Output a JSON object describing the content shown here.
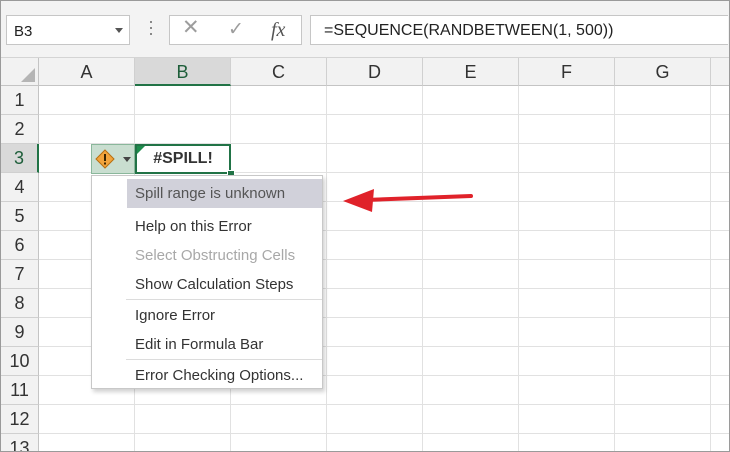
{
  "formula_bar": {
    "name_box": "B3",
    "cancel_glyph": "✕",
    "enter_glyph": "✓",
    "fx_glyph": "fx",
    "formula": "=SEQUENCE(RANDBETWEEN(1, 500))"
  },
  "grid": {
    "columns": [
      "A",
      "B",
      "C",
      "D",
      "E",
      "F",
      "G"
    ],
    "rows": [
      "1",
      "2",
      "3",
      "4",
      "5",
      "6",
      "7",
      "8",
      "9",
      "10",
      "11",
      "12",
      "13"
    ],
    "active_column": "B",
    "active_row": "3"
  },
  "active_cell": {
    "value": "#SPILL!"
  },
  "error_menu": {
    "header": "Spill range is unknown",
    "items": [
      {
        "label": "Help on this Error"
      },
      {
        "label": "Select Obstructing Cells"
      },
      {
        "label": "Show Calculation Steps"
      },
      {
        "label": "Ignore Error"
      },
      {
        "label": "Edit in Formula Bar"
      },
      {
        "label": "Error Checking Options..."
      }
    ]
  },
  "colors": {
    "accent": "#217346",
    "annotation_arrow": "#e0222a",
    "warning_icon": "#f0a030"
  },
  "icons": {
    "smart_tag": "warning-icon",
    "annotation": "red-arrow-icon"
  }
}
